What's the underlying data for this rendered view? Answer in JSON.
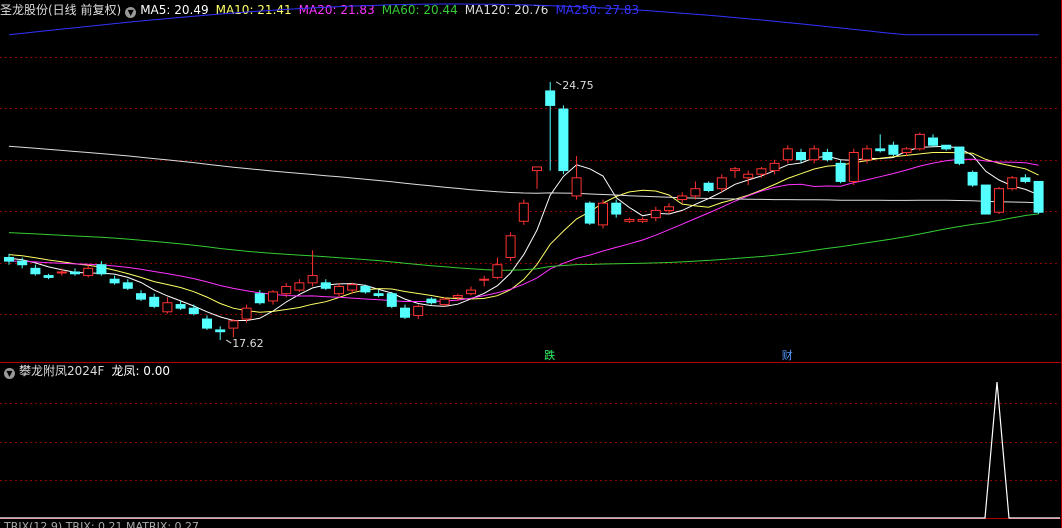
{
  "header": {
    "stock_name": "圣龙股份(日线 前复权)",
    "ma_legend": [
      {
        "label": "MA5: 20.49",
        "color": "#ffffff"
      },
      {
        "label": "MA10: 21.41",
        "color": "#ffff66"
      },
      {
        "label": "MA20: 21.83",
        "color": "#ff33ff"
      },
      {
        "label": "MA60: 20.44",
        "color": "#33cc33"
      },
      {
        "label": "MA120: 20.76",
        "color": "#dddddd"
      },
      {
        "label": "MA250: 27.83",
        "color": "#3333ff"
      }
    ]
  },
  "indicator_panel": {
    "title": "攀龙附凤2024F",
    "value_label": "龙凤: 0.00"
  },
  "bottom_panel": {
    "label": "TRIX(12,9)  TRIX: 0.21  MATRIX: 0.27"
  },
  "colors": {
    "up": "#ff3333",
    "down": "#54ffff",
    "grid": "#8b0000"
  },
  "chart_data": {
    "type": "candlestick",
    "price_range": [
      17.0,
      26.5
    ],
    "annotations": [
      {
        "text": "24.75",
        "value": 24.75
      },
      {
        "text": "17.62",
        "value": 17.62
      }
    ],
    "event_markers": [
      {
        "text": "跌",
        "color": "#33ff66"
      },
      {
        "text": "财",
        "color": "#5599ff"
      }
    ],
    "candles": [
      {
        "o": 19.9,
        "h": 20.0,
        "l": 19.7,
        "c": 19.8
      },
      {
        "o": 19.8,
        "h": 19.9,
        "l": 19.6,
        "c": 19.7
      },
      {
        "o": 19.6,
        "h": 19.7,
        "l": 19.4,
        "c": 19.45
      },
      {
        "o": 19.4,
        "h": 19.45,
        "l": 19.3,
        "c": 19.35
      },
      {
        "o": 19.5,
        "h": 19.6,
        "l": 19.4,
        "c": 19.5
      },
      {
        "o": 19.5,
        "h": 19.6,
        "l": 19.4,
        "c": 19.45
      },
      {
        "o": 19.4,
        "h": 19.7,
        "l": 19.35,
        "c": 19.6
      },
      {
        "o": 19.7,
        "h": 19.8,
        "l": 19.4,
        "c": 19.45
      },
      {
        "o": 19.3,
        "h": 19.4,
        "l": 19.15,
        "c": 19.2
      },
      {
        "o": 19.2,
        "h": 19.3,
        "l": 19.0,
        "c": 19.05
      },
      {
        "o": 18.9,
        "h": 19.0,
        "l": 18.7,
        "c": 18.75
      },
      {
        "o": 18.8,
        "h": 18.9,
        "l": 18.5,
        "c": 18.55
      },
      {
        "o": 18.4,
        "h": 18.8,
        "l": 18.35,
        "c": 18.65
      },
      {
        "o": 18.6,
        "h": 18.7,
        "l": 18.45,
        "c": 18.5
      },
      {
        "o": 18.5,
        "h": 18.6,
        "l": 18.3,
        "c": 18.35
      },
      {
        "o": 18.2,
        "h": 18.3,
        "l": 17.9,
        "c": 17.95
      },
      {
        "o": 17.9,
        "h": 18.0,
        "l": 17.62,
        "c": 17.85
      },
      {
        "o": 17.95,
        "h": 18.2,
        "l": 17.7,
        "c": 18.15
      },
      {
        "o": 18.2,
        "h": 18.6,
        "l": 18.1,
        "c": 18.5
      },
      {
        "o": 18.9,
        "h": 19.0,
        "l": 18.6,
        "c": 18.65
      },
      {
        "o": 18.7,
        "h": 19.0,
        "l": 18.6,
        "c": 18.95
      },
      {
        "o": 18.9,
        "h": 19.2,
        "l": 18.8,
        "c": 19.1
      },
      {
        "o": 19.0,
        "h": 19.3,
        "l": 18.95,
        "c": 19.2
      },
      {
        "o": 19.2,
        "h": 20.1,
        "l": 19.1,
        "c": 19.4
      },
      {
        "o": 19.2,
        "h": 19.3,
        "l": 19.0,
        "c": 19.05
      },
      {
        "o": 18.9,
        "h": 19.2,
        "l": 18.8,
        "c": 19.1
      },
      {
        "o": 19.0,
        "h": 19.2,
        "l": 18.9,
        "c": 19.15
      },
      {
        "o": 19.1,
        "h": 19.15,
        "l": 18.9,
        "c": 18.95
      },
      {
        "o": 18.9,
        "h": 19.0,
        "l": 18.8,
        "c": 18.85
      },
      {
        "o": 18.9,
        "h": 18.95,
        "l": 18.5,
        "c": 18.55
      },
      {
        "o": 18.5,
        "h": 18.6,
        "l": 18.2,
        "c": 18.25
      },
      {
        "o": 18.3,
        "h": 18.6,
        "l": 18.2,
        "c": 18.55
      },
      {
        "o": 18.75,
        "h": 18.8,
        "l": 18.6,
        "c": 18.65
      },
      {
        "o": 18.6,
        "h": 18.8,
        "l": 18.55,
        "c": 18.75
      },
      {
        "o": 18.8,
        "h": 18.9,
        "l": 18.7,
        "c": 18.85
      },
      {
        "o": 18.9,
        "h": 19.1,
        "l": 18.85,
        "c": 19.0
      },
      {
        "o": 19.3,
        "h": 19.4,
        "l": 19.1,
        "c": 19.3
      },
      {
        "o": 19.35,
        "h": 19.9,
        "l": 19.3,
        "c": 19.7
      },
      {
        "o": 19.9,
        "h": 20.6,
        "l": 19.8,
        "c": 20.5
      },
      {
        "o": 20.9,
        "h": 21.5,
        "l": 20.8,
        "c": 21.4
      },
      {
        "o": 22.3,
        "h": 22.4,
        "l": 21.8,
        "c": 22.4
      },
      {
        "o": 24.5,
        "h": 24.75,
        "l": 22.3,
        "c": 24.1
      },
      {
        "o": 24.0,
        "h": 24.1,
        "l": 22.2,
        "c": 22.3
      },
      {
        "o": 21.6,
        "h": 22.7,
        "l": 21.5,
        "c": 22.1
      },
      {
        "o": 21.4,
        "h": 21.45,
        "l": 20.8,
        "c": 20.85
      },
      {
        "o": 20.8,
        "h": 21.5,
        "l": 20.7,
        "c": 21.4
      },
      {
        "o": 21.4,
        "h": 21.5,
        "l": 21.0,
        "c": 21.1
      },
      {
        "o": 20.9,
        "h": 21.0,
        "l": 20.85,
        "c": 20.95
      },
      {
        "o": 20.9,
        "h": 21.0,
        "l": 20.85,
        "c": 20.95
      },
      {
        "o": 21.0,
        "h": 21.3,
        "l": 20.9,
        "c": 21.2
      },
      {
        "o": 21.2,
        "h": 21.4,
        "l": 21.1,
        "c": 21.3
      },
      {
        "o": 21.5,
        "h": 21.7,
        "l": 21.4,
        "c": 21.6
      },
      {
        "o": 21.6,
        "h": 22.0,
        "l": 21.5,
        "c": 21.8
      },
      {
        "o": 21.95,
        "h": 22.0,
        "l": 21.7,
        "c": 21.75
      },
      {
        "o": 21.8,
        "h": 22.2,
        "l": 21.7,
        "c": 22.1
      },
      {
        "o": 22.3,
        "h": 22.4,
        "l": 22.1,
        "c": 22.35
      },
      {
        "o": 22.1,
        "h": 22.3,
        "l": 21.9,
        "c": 22.2
      },
      {
        "o": 22.2,
        "h": 22.4,
        "l": 22.1,
        "c": 22.35
      },
      {
        "o": 22.3,
        "h": 22.6,
        "l": 22.2,
        "c": 22.5
      },
      {
        "o": 22.6,
        "h": 23.0,
        "l": 22.5,
        "c": 22.9
      },
      {
        "o": 22.8,
        "h": 22.9,
        "l": 22.5,
        "c": 22.6
      },
      {
        "o": 22.6,
        "h": 23.0,
        "l": 22.5,
        "c": 22.9
      },
      {
        "o": 22.8,
        "h": 22.9,
        "l": 22.55,
        "c": 22.6
      },
      {
        "o": 22.5,
        "h": 22.6,
        "l": 21.95,
        "c": 22.0
      },
      {
        "o": 22.0,
        "h": 22.9,
        "l": 21.9,
        "c": 22.8
      },
      {
        "o": 22.6,
        "h": 23.0,
        "l": 22.5,
        "c": 22.9
      },
      {
        "o": 22.9,
        "h": 23.3,
        "l": 22.8,
        "c": 22.85
      },
      {
        "o": 23.0,
        "h": 23.1,
        "l": 22.7,
        "c": 22.75
      },
      {
        "o": 22.8,
        "h": 22.95,
        "l": 22.7,
        "c": 22.9
      },
      {
        "o": 22.9,
        "h": 23.35,
        "l": 22.85,
        "c": 23.3
      },
      {
        "o": 23.2,
        "h": 23.3,
        "l": 22.95,
        "c": 23.0
      },
      {
        "o": 23.0,
        "h": 23.0,
        "l": 22.85,
        "c": 22.9
      },
      {
        "o": 22.95,
        "h": 22.95,
        "l": 22.45,
        "c": 22.5
      },
      {
        "o": 22.25,
        "h": 22.3,
        "l": 21.85,
        "c": 21.9
      },
      {
        "o": 21.9,
        "h": 21.9,
        "l": 21.1,
        "c": 21.1
      },
      {
        "o": 21.15,
        "h": 21.85,
        "l": 21.1,
        "c": 21.8
      },
      {
        "o": 21.8,
        "h": 22.15,
        "l": 21.75,
        "c": 22.1
      },
      {
        "o": 22.1,
        "h": 22.2,
        "l": 21.95,
        "c": 22.0
      },
      {
        "o": 22.0,
        "h": 22.0,
        "l": 21.1,
        "c": 21.15
      }
    ],
    "indicator": {
      "name": "龙凤",
      "spike_value": 1,
      "spike_index": 70
    }
  }
}
